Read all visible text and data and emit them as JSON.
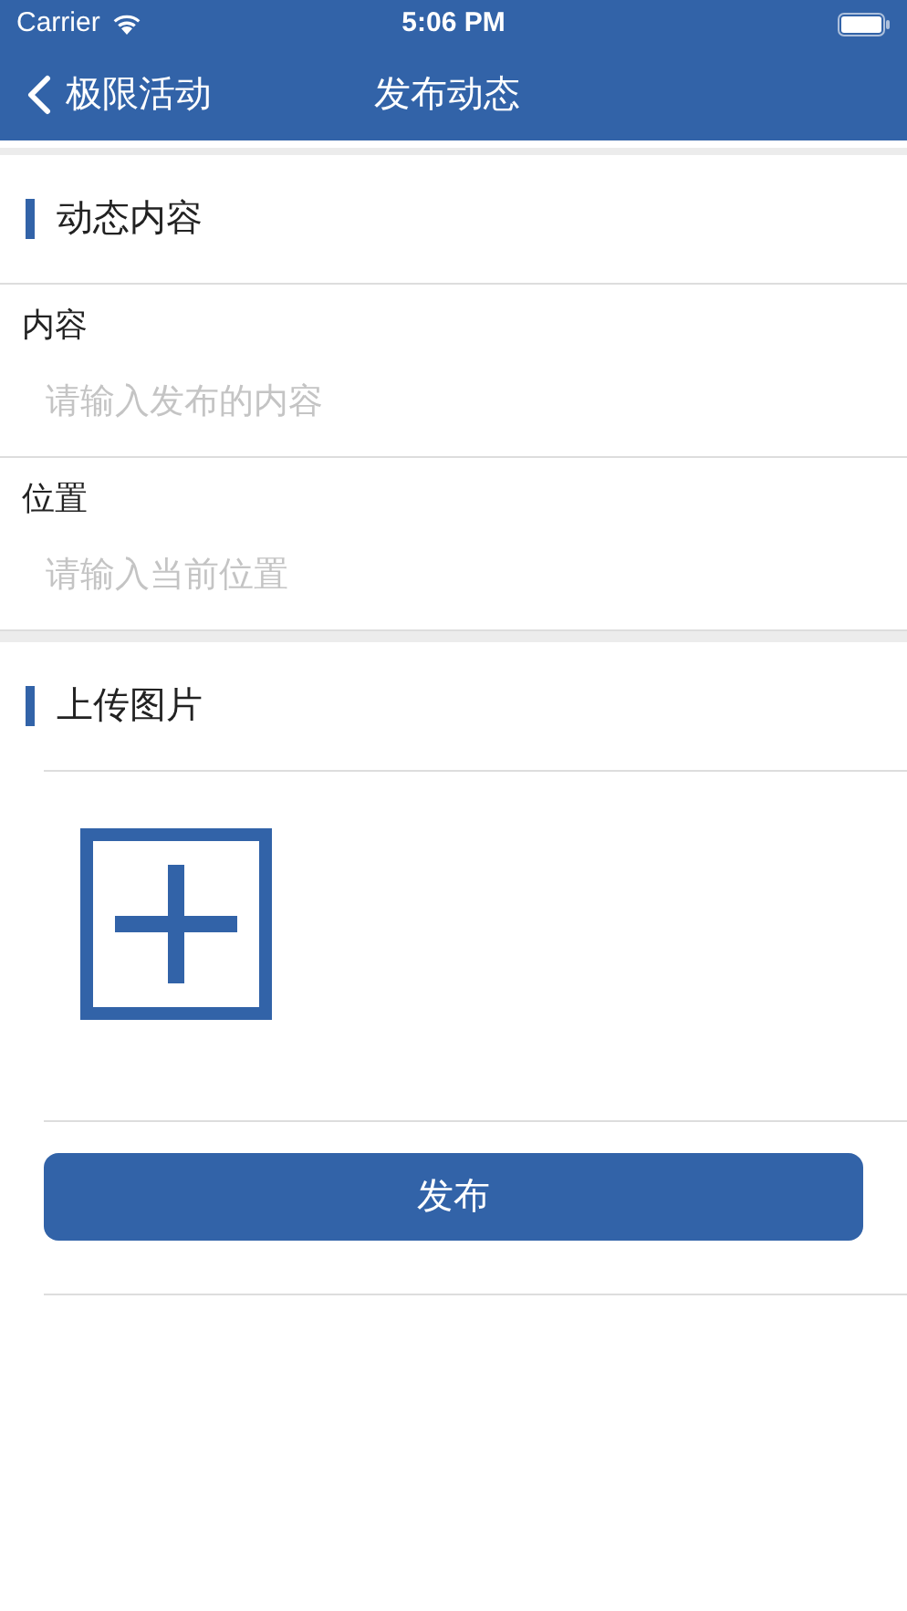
{
  "status_bar": {
    "carrier": "Carrier",
    "time": "5:06 PM"
  },
  "nav": {
    "back_label": "极限活动",
    "title": "发布动态"
  },
  "sections": [
    {
      "kind": "form",
      "title": "动态内容",
      "fields": [
        {
          "label": "内容",
          "placeholder": "请输入发布的内容"
        },
        {
          "label": "位置",
          "placeholder": "请输入当前位置"
        }
      ]
    },
    {
      "kind": "upload",
      "title": "上传图片"
    }
  ],
  "submit": "发布"
}
